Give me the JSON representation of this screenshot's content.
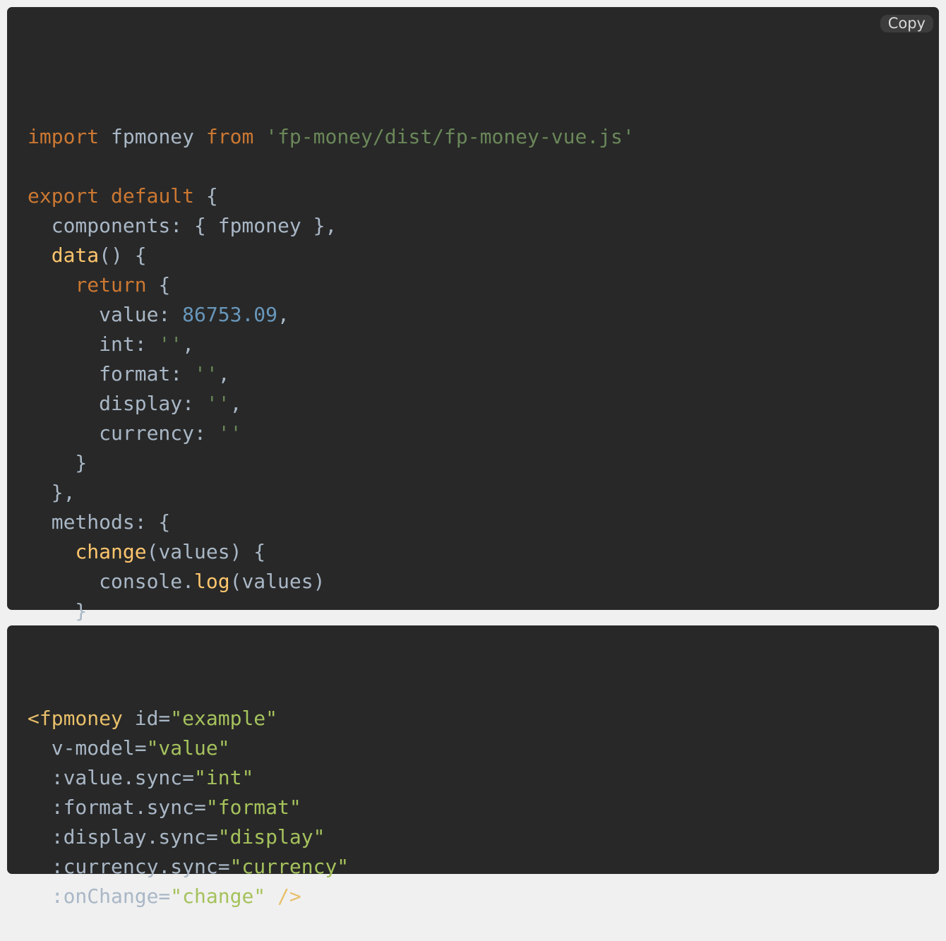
{
  "colors": {
    "page_background": "#f0f0f0",
    "code_background": "#282828",
    "keyword": "#cc7832",
    "string": "#6a8759",
    "number": "#6897bb",
    "function": "#ffc66d",
    "tag": "#e8bf6a",
    "attribute_value": "#a5c25c",
    "plain": "#a9b7c6"
  },
  "js_block": {
    "copy_label": "Copy",
    "lines": [
      [
        {
          "t": "import",
          "c": "kw"
        },
        {
          "t": " fpmoney ",
          "c": "plain"
        },
        {
          "t": "from",
          "c": "kw"
        },
        {
          "t": " ",
          "c": "plain"
        },
        {
          "t": "'fp-money/dist/fp-money-vue.js'",
          "c": "str"
        }
      ],
      [],
      [
        {
          "t": "export",
          "c": "kw"
        },
        {
          "t": " ",
          "c": "plain"
        },
        {
          "t": "default",
          "c": "kw"
        },
        {
          "t": " {",
          "c": "plain"
        }
      ],
      [
        {
          "t": "  components: { fpmoney },",
          "c": "plain"
        }
      ],
      [
        {
          "t": "  ",
          "c": "plain"
        },
        {
          "t": "data",
          "c": "fn"
        },
        {
          "t": "() {",
          "c": "plain"
        }
      ],
      [
        {
          "t": "    ",
          "c": "plain"
        },
        {
          "t": "return",
          "c": "kw"
        },
        {
          "t": " {",
          "c": "plain"
        }
      ],
      [
        {
          "t": "      value: ",
          "c": "plain"
        },
        {
          "t": "86753.09",
          "c": "num"
        },
        {
          "t": ",",
          "c": "plain"
        }
      ],
      [
        {
          "t": "      int: ",
          "c": "plain"
        },
        {
          "t": "''",
          "c": "str"
        },
        {
          "t": ",",
          "c": "plain"
        }
      ],
      [
        {
          "t": "      format: ",
          "c": "plain"
        },
        {
          "t": "''",
          "c": "str"
        },
        {
          "t": ",",
          "c": "plain"
        }
      ],
      [
        {
          "t": "      display: ",
          "c": "plain"
        },
        {
          "t": "''",
          "c": "str"
        },
        {
          "t": ",",
          "c": "plain"
        }
      ],
      [
        {
          "t": "      currency: ",
          "c": "plain"
        },
        {
          "t": "''",
          "c": "str"
        }
      ],
      [
        {
          "t": "    }",
          "c": "plain"
        }
      ],
      [
        {
          "t": "  },",
          "c": "plain"
        }
      ],
      [
        {
          "t": "  methods: {",
          "c": "plain"
        }
      ],
      [
        {
          "t": "    ",
          "c": "plain"
        },
        {
          "t": "change",
          "c": "fn"
        },
        {
          "t": "(values) {",
          "c": "plain"
        }
      ],
      [
        {
          "t": "      console.",
          "c": "plain"
        },
        {
          "t": "log",
          "c": "fn"
        },
        {
          "t": "(values)",
          "c": "plain"
        }
      ],
      [
        {
          "t": "    }",
          "c": "plain"
        }
      ],
      [
        {
          "t": "  }",
          "c": "plain"
        }
      ],
      [
        {
          "t": "}",
          "c": "plain"
        }
      ]
    ]
  },
  "template_block": {
    "lines": [
      [
        {
          "t": "<fpmoney",
          "c": "tag"
        },
        {
          "t": " id=",
          "c": "plain"
        },
        {
          "t": "\"example\"",
          "c": "attrv"
        }
      ],
      [
        {
          "t": "  v-model=",
          "c": "plain"
        },
        {
          "t": "\"value\"",
          "c": "attrv"
        }
      ],
      [
        {
          "t": "  :value.sync=",
          "c": "plain"
        },
        {
          "t": "\"int\"",
          "c": "attrv"
        }
      ],
      [
        {
          "t": "  :format.sync=",
          "c": "plain"
        },
        {
          "t": "\"format\"",
          "c": "attrv"
        }
      ],
      [
        {
          "t": "  :display.sync=",
          "c": "plain"
        },
        {
          "t": "\"display\"",
          "c": "attrv"
        }
      ],
      [
        {
          "t": "  :currency.sync=",
          "c": "plain"
        },
        {
          "t": "\"currency\"",
          "c": "attrv"
        }
      ],
      [
        {
          "t": "  :onChange=",
          "c": "plain"
        },
        {
          "t": "\"change\"",
          "c": "attrv"
        },
        {
          "t": " ",
          "c": "plain"
        },
        {
          "t": "/>",
          "c": "tag"
        }
      ]
    ]
  }
}
